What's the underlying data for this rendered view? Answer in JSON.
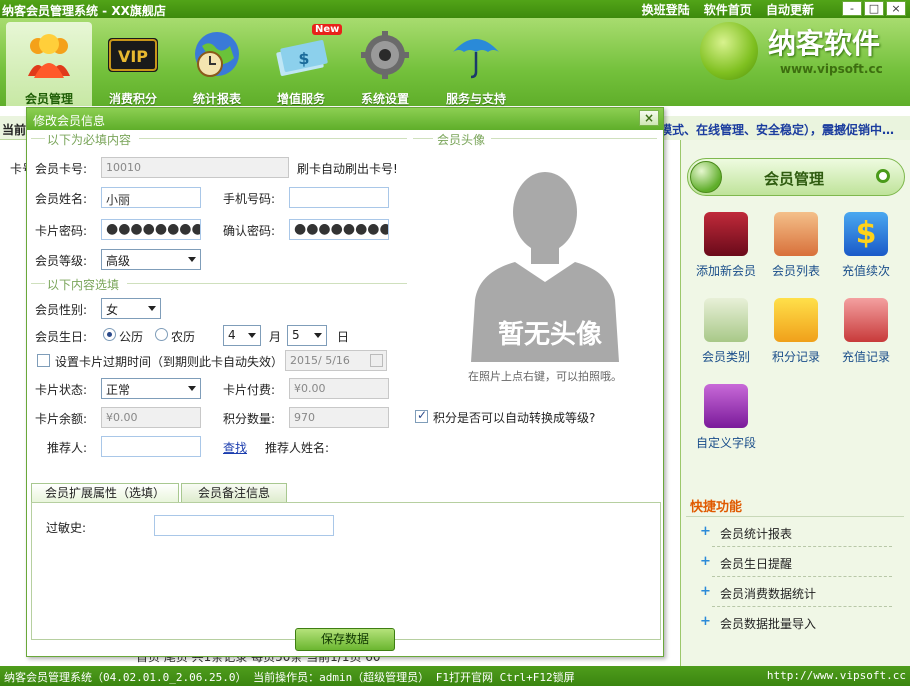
{
  "window": {
    "title": "纳客会员管理系统 - XX旗舰店",
    "links": [
      "换班登陆",
      "软件首页",
      "自动更新"
    ],
    "controls": [
      "-",
      "□",
      "×"
    ]
  },
  "toolbar": {
    "items": [
      {
        "label": "会员管理",
        "active": true
      },
      {
        "label": "消费积分",
        "active": false
      },
      {
        "label": "统计报表",
        "active": false
      },
      {
        "label": "增值服务",
        "active": false,
        "badge": "New"
      },
      {
        "label": "系统设置",
        "active": false
      },
      {
        "label": "服务与支持",
        "active": false
      }
    ],
    "vip_text": "VIP"
  },
  "logo": {
    "name": "纳客软件",
    "url": "www.vipsoft.cc"
  },
  "current_strip": {
    "label": "当前"
  },
  "marquee": "模式、在线管理、安全稳定），震撼促销中…",
  "background_left": {
    "label_card": "卡号",
    "bottom_text": "首页   尾页     共1条记录  每页50条  当前1/1页                              60"
  },
  "dialog": {
    "title": "修改会员信息",
    "close": "×",
    "section_required": "以下为必填内容",
    "section_optional": "以下内容选填",
    "section_avatar": "会员头像",
    "card_no_label": "会员卡号:",
    "card_no_value": "10010",
    "swipe_hint": "刷卡自动刷出卡号!",
    "name_label": "会员姓名:",
    "name_value": "小丽",
    "phone_label": "手机号码:",
    "phone_value": "",
    "pwd_label": "卡片密码:",
    "pwd_value": "●●●●●●●●",
    "confirm_label": "确认密码:",
    "confirm_value": "●●●●●●●●",
    "level_label": "会员等级:",
    "level_value": "高级",
    "gender_label": "会员性别:",
    "gender_value": "女",
    "birthday_label": "会员生日:",
    "calendar_solar": "公历",
    "calendar_lunar": "农历",
    "month_value": "4",
    "month_unit": "月",
    "day_value": "5",
    "day_unit": "日",
    "expire_label": "设置卡片过期时间（到期则此卡自动失效）",
    "expire_date": "2015/ 5/16",
    "status_label": "卡片状态:",
    "status_value": "正常",
    "fee_label": "卡片付费:",
    "fee_value": "¥0.00",
    "balance_label": "卡片余额:",
    "balance_value": "¥0.00",
    "points_label": "积分数量:",
    "points_value": "970",
    "auto_level_label": "积分是否可以自动转换成等级?",
    "referrer_label": "推荐人:",
    "referrer_value": "",
    "find_link": "查找",
    "referrer_name_label": "推荐人姓名:",
    "avatar_text": "暂无头像",
    "avatar_hint": "在照片上点右键，可以拍照哦。",
    "tabs": [
      "会员扩展属性（选填）",
      "会员备注信息"
    ],
    "allergy_label": "过敏史:",
    "allergy_value": "",
    "save_button": "保存数据"
  },
  "right_panel": {
    "title": "会员管理",
    "items": [
      "添加新会员",
      "会员列表",
      "充值续次",
      "会员类别",
      "积分记录",
      "充值记录",
      "自定义字段"
    ],
    "quick_title": "快捷功能",
    "quick_items": [
      "会员统计报表",
      "会员生日提醒",
      "会员消费数据统计",
      "会员数据批量导入"
    ]
  },
  "footer": {
    "left": "纳客会员管理系统（04.02.01.0_2.06.25.0） 当前操作员：admin（超级管理员） F1打开官网 Ctrl+F12锁屏",
    "right": "http://www.vipsoft.cc"
  },
  "colors": {
    "accent": "#5fae2a",
    "dark_green": "#3d8a0c",
    "link": "#1a3cae",
    "quick": "#e05a00"
  }
}
